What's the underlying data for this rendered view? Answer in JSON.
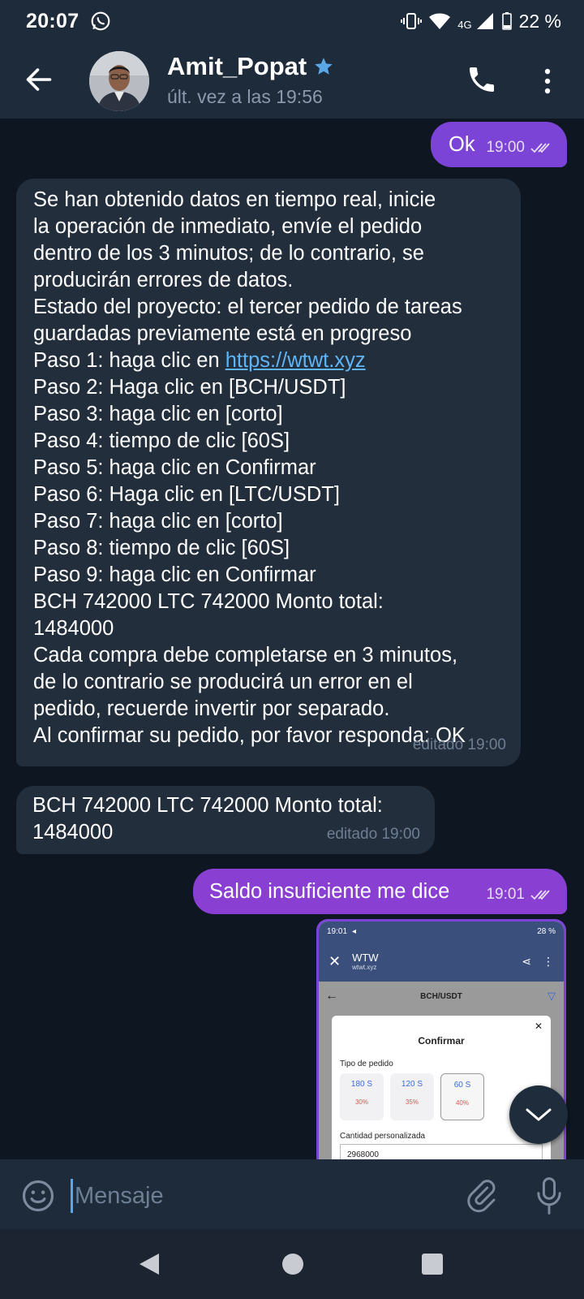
{
  "status_bar": {
    "time": "20:07",
    "network": "4G",
    "battery": "22 %"
  },
  "header": {
    "contact_name": "Amit_Popat",
    "last_seen": "últ. vez a las 19:56"
  },
  "messages": [
    {
      "direction": "out",
      "text": "Ok",
      "time": "19:00"
    },
    {
      "direction": "in",
      "lines": [
        "Se han obtenido datos en tiempo real, inicie",
        "la operación de inmediato, envíe el pedido",
        "dentro de los 3 minutos; de lo contrario, se",
        "producirán errores de datos.",
        "Estado del proyecto: el tercer pedido de tareas",
        "guardadas previamente está en progreso"
      ],
      "link_prefix": "Paso 1: haga clic en ",
      "link": "https://wtwt.xyz",
      "lines2": [
        "Paso 2: Haga clic en [BCH/USDT]",
        "Paso 3: haga clic en [corto]",
        "Paso 4: tiempo de clic [60S]",
        "Paso 5: haga clic en Confirmar",
        "Paso 6: Haga clic en [LTC/USDT]",
        "Paso 7: haga clic en [corto]",
        "Paso 8: tiempo de clic [60S]",
        "Paso 9: haga clic en Confirmar",
        "BCH 742000 LTC 742000 Monto total:",
        "1484000",
        "Cada compra debe completarse en 3 minutos,",
        "de lo contrario se producirá un error en el",
        "pedido, recuerde invertir por separado.",
        "Al confirmar su pedido, por favor responda: OK"
      ],
      "time": "editado 19:00"
    },
    {
      "direction": "in",
      "lines": [
        "BCH 742000 LTC 742000 Monto total:",
        "1484000"
      ],
      "time": "editado 19:00"
    },
    {
      "direction": "out",
      "text": "Saldo insuficiente me dice",
      "time": "19:01"
    }
  ],
  "screenshot_preview": {
    "status_time": "19:01",
    "status_right": "28 %",
    "site_name": "WTW",
    "site_url": "wtwt.xyz",
    "pair": "BCH/USDT",
    "dialog_title": "Confirmar",
    "order_type_label": "Tipo de pedido",
    "options": [
      {
        "time": "180 S",
        "percent": "30%"
      },
      {
        "time": "120 S",
        "percent": "35%"
      },
      {
        "time": "60 S",
        "percent": "40%"
      }
    ],
    "custom_amount_label": "Cantidad personalizada",
    "custom_amount": "2968000"
  },
  "composer": {
    "placeholder": "Mensaje"
  }
}
